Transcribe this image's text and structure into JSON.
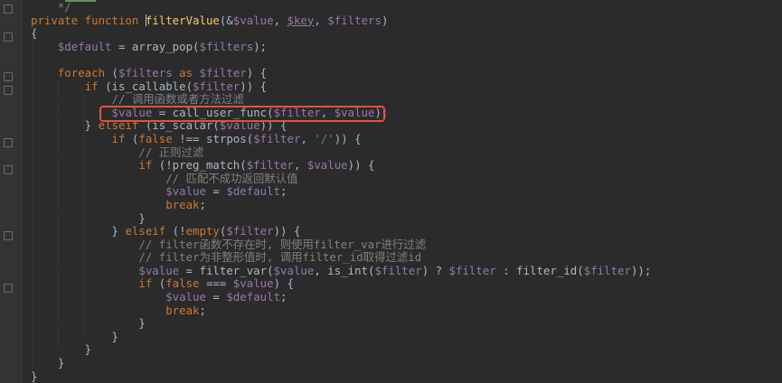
{
  "editor": {
    "language": "PHP",
    "colors": {
      "background": "#2b2b2b",
      "keyword": "#cc7832",
      "function": "#ffc66d",
      "variable": "#9876aa",
      "string": "#6a8759",
      "comment": "#808080",
      "highlight_box": "#e5503b"
    },
    "highlighted_line": 8,
    "lines": [
      [
        {
          "c": "cmt-doc",
          "t": "    */"
        }
      ],
      [
        {
          "c": "kw",
          "t": "private function "
        },
        {
          "c": "caret",
          "t": ""
        },
        {
          "c": "fn",
          "t": "filterValue"
        },
        {
          "c": "txt",
          "t": "(&"
        },
        {
          "c": "var",
          "t": "$value"
        },
        {
          "c": "txt",
          "t": ", "
        },
        {
          "c": "var under",
          "t": "$key"
        },
        {
          "c": "txt",
          "t": ", "
        },
        {
          "c": "var",
          "t": "$filters"
        },
        {
          "c": "txt",
          "t": ")"
        }
      ],
      [
        {
          "c": "txt",
          "t": "{"
        }
      ],
      [
        {
          "c": "txt",
          "t": "    "
        },
        {
          "c": "var",
          "t": "$default"
        },
        {
          "c": "txt",
          "t": " = array_pop("
        },
        {
          "c": "var",
          "t": "$filters"
        },
        {
          "c": "txt",
          "t": ");"
        }
      ],
      [
        {
          "c": "txt",
          "t": ""
        }
      ],
      [
        {
          "c": "txt",
          "t": "    "
        },
        {
          "c": "kw",
          "t": "foreach"
        },
        {
          "c": "txt",
          "t": " ("
        },
        {
          "c": "var",
          "t": "$filters"
        },
        {
          "c": "kw",
          "t": " as "
        },
        {
          "c": "var",
          "t": "$filter"
        },
        {
          "c": "txt",
          "t": ") {"
        }
      ],
      [
        {
          "c": "txt",
          "t": "        "
        },
        {
          "c": "kw",
          "t": "if"
        },
        {
          "c": "txt",
          "t": " (is_callable("
        },
        {
          "c": "var",
          "t": "$filter"
        },
        {
          "c": "txt",
          "t": ")) {"
        }
      ],
      [
        {
          "c": "cmt",
          "t": "            // 调用函数或者方法过滤"
        }
      ],
      [
        {
          "c": "txt",
          "t": "            "
        },
        {
          "c": "var",
          "t": "$value"
        },
        {
          "c": "txt",
          "t": " = call_user_func("
        },
        {
          "c": "var",
          "t": "$filter"
        },
        {
          "c": "txt",
          "t": ", "
        },
        {
          "c": "var",
          "t": "$value"
        },
        {
          "c": "txt",
          "t": ");"
        }
      ],
      [
        {
          "c": "txt",
          "t": "        } "
        },
        {
          "c": "kw",
          "t": "elseif"
        },
        {
          "c": "txt",
          "t": " (is_scalar("
        },
        {
          "c": "var",
          "t": "$value"
        },
        {
          "c": "txt",
          "t": ")) {"
        }
      ],
      [
        {
          "c": "txt",
          "t": "            "
        },
        {
          "c": "kw",
          "t": "if"
        },
        {
          "c": "txt",
          "t": " ("
        },
        {
          "c": "kw",
          "t": "false"
        },
        {
          "c": "txt",
          "t": " !== strpos("
        },
        {
          "c": "var",
          "t": "$filter"
        },
        {
          "c": "txt",
          "t": ", "
        },
        {
          "c": "str",
          "t": "'/'"
        },
        {
          "c": "txt",
          "t": ")) {"
        }
      ],
      [
        {
          "c": "cmt",
          "t": "                // 正则过滤"
        }
      ],
      [
        {
          "c": "txt",
          "t": "                "
        },
        {
          "c": "kw",
          "t": "if"
        },
        {
          "c": "txt",
          "t": " (!preg_match("
        },
        {
          "c": "var",
          "t": "$filter"
        },
        {
          "c": "txt",
          "t": ", "
        },
        {
          "c": "var",
          "t": "$value"
        },
        {
          "c": "txt",
          "t": ")) {"
        }
      ],
      [
        {
          "c": "cmt",
          "t": "                    // 匹配不成功返回默认值"
        }
      ],
      [
        {
          "c": "txt",
          "t": "                    "
        },
        {
          "c": "var",
          "t": "$value"
        },
        {
          "c": "txt",
          "t": " = "
        },
        {
          "c": "var",
          "t": "$default"
        },
        {
          "c": "txt",
          "t": ";"
        }
      ],
      [
        {
          "c": "txt",
          "t": "                    "
        },
        {
          "c": "kw",
          "t": "break"
        },
        {
          "c": "txt",
          "t": ";"
        }
      ],
      [
        {
          "c": "txt",
          "t": "                }"
        }
      ],
      [
        {
          "c": "txt",
          "t": "            } "
        },
        {
          "c": "kw",
          "t": "elseif"
        },
        {
          "c": "txt",
          "t": " (!"
        },
        {
          "c": "kw",
          "t": "empty"
        },
        {
          "c": "txt",
          "t": "("
        },
        {
          "c": "var",
          "t": "$filter"
        },
        {
          "c": "txt",
          "t": ")) {"
        }
      ],
      [
        {
          "c": "cmt",
          "t": "                // filter函数不存在时, 则使用filter_var进行过滤"
        }
      ],
      [
        {
          "c": "cmt",
          "t": "                // filter为非整形值时, 调用filter_id取得过滤id"
        }
      ],
      [
        {
          "c": "txt",
          "t": "                "
        },
        {
          "c": "var",
          "t": "$value"
        },
        {
          "c": "txt",
          "t": " = filter_var("
        },
        {
          "c": "var",
          "t": "$value"
        },
        {
          "c": "txt",
          "t": ", is_int("
        },
        {
          "c": "var",
          "t": "$filter"
        },
        {
          "c": "txt",
          "t": ") ? "
        },
        {
          "c": "var",
          "t": "$filter"
        },
        {
          "c": "txt",
          "t": " : filter_id("
        },
        {
          "c": "var",
          "t": "$filter"
        },
        {
          "c": "txt",
          "t": "));"
        }
      ],
      [
        {
          "c": "txt",
          "t": "                "
        },
        {
          "c": "kw",
          "t": "if"
        },
        {
          "c": "txt",
          "t": " ("
        },
        {
          "c": "kw",
          "t": "false"
        },
        {
          "c": "txt",
          "t": " === "
        },
        {
          "c": "var",
          "t": "$value"
        },
        {
          "c": "txt",
          "t": ") {"
        }
      ],
      [
        {
          "c": "txt",
          "t": "                    "
        },
        {
          "c": "var",
          "t": "$value"
        },
        {
          "c": "txt",
          "t": " = "
        },
        {
          "c": "var",
          "t": "$default"
        },
        {
          "c": "txt",
          "t": ";"
        }
      ],
      [
        {
          "c": "txt",
          "t": "                    "
        },
        {
          "c": "kw",
          "t": "break"
        },
        {
          "c": "txt",
          "t": ";"
        }
      ],
      [
        {
          "c": "txt",
          "t": "                }"
        }
      ],
      [
        {
          "c": "txt",
          "t": "            }"
        }
      ],
      [
        {
          "c": "txt",
          "t": "        }"
        }
      ],
      [
        {
          "c": "txt",
          "t": "    }"
        }
      ],
      [
        {
          "c": "txt",
          "t": "}"
        }
      ]
    ]
  }
}
